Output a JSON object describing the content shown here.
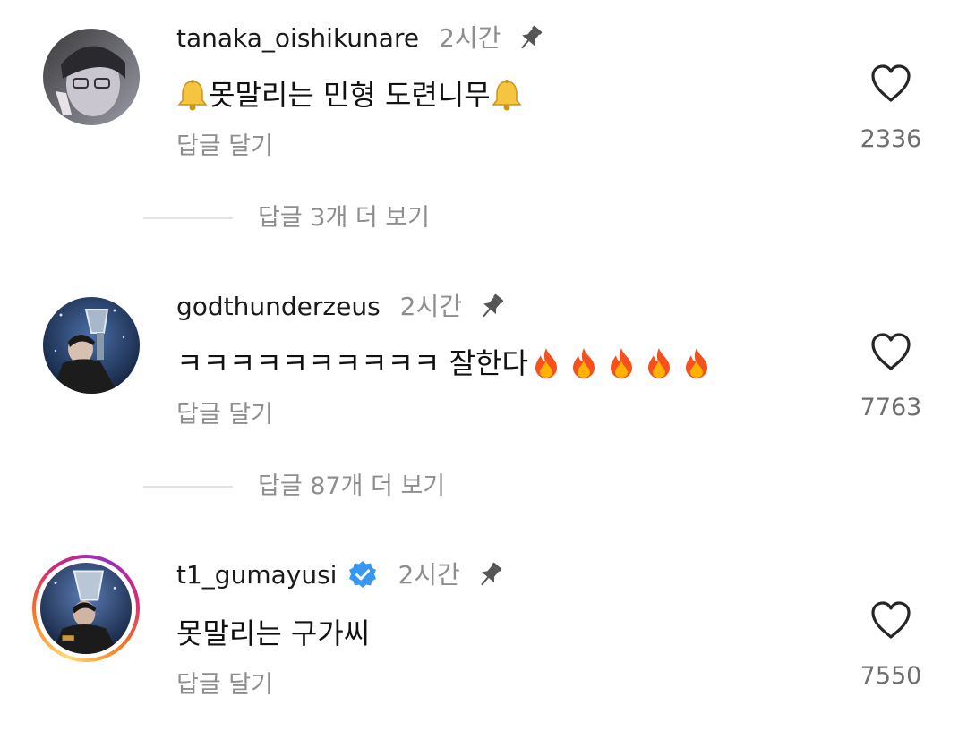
{
  "colors": {
    "muted_text": "#8e8e8e",
    "verified_blue": "#3897f0",
    "story_ring": [
      "#feda75",
      "#fa7e1e",
      "#d62976",
      "#962fbf"
    ]
  },
  "comments": [
    {
      "username": "tanaka_oishikunare",
      "time": "2시간",
      "pinned": true,
      "verified": false,
      "text_before": "",
      "text_main": "못말리는 민형 도련니무",
      "text_after": "",
      "leading_emoji": "bell-emoji",
      "trailing_emoji": "bell-emoji",
      "reply_label": "답글 달기",
      "like_count": "2336",
      "more_replies": "답글 3개 더 보기"
    },
    {
      "username": "godthunderzeus",
      "time": "2시간",
      "pinned": true,
      "verified": false,
      "text_main": "ㅋㅋㅋㅋㅋㅋㅋㅋㅋㅋ 잘한다",
      "trailing_emoji": "fire-emoji x5",
      "reply_label": "답글 달기",
      "like_count": "7763",
      "more_replies": "답글 87개 더 보기"
    },
    {
      "username": "t1_gumayusi",
      "time": "2시간",
      "pinned": true,
      "verified": true,
      "text_main": "못말리는 구가씨",
      "reply_label": "답글 달기",
      "like_count": "7550"
    }
  ]
}
